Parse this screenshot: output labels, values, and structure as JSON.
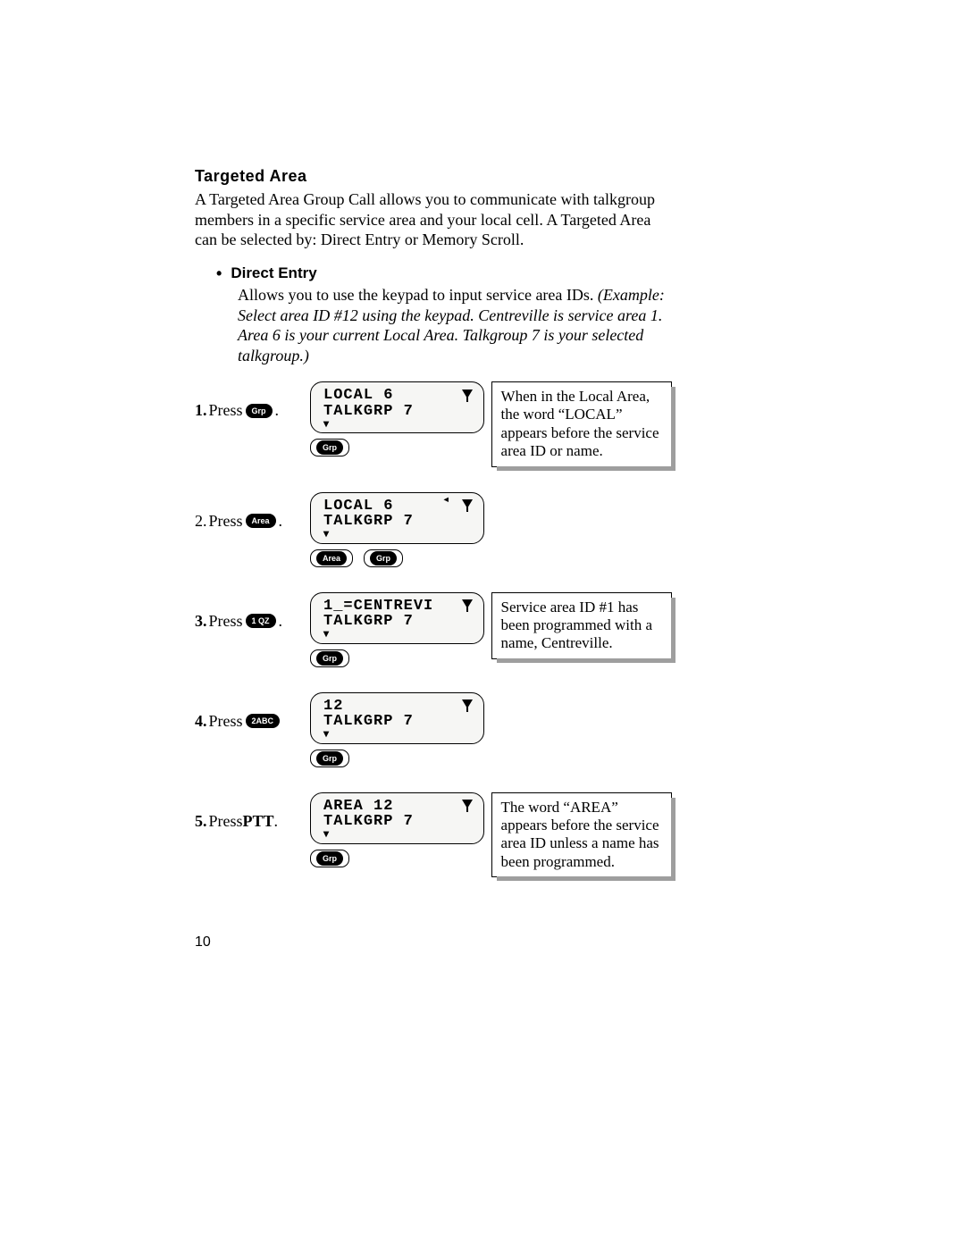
{
  "heading": "Targeted  Area",
  "intro": "A Targeted Area Group Call allows you to communicate with talkgroup members in a specific service area and your local cell. A Targeted Area can be selected by: Direct Entry or Memory Scroll.",
  "sub": {
    "bullet": "•",
    "title": "Direct Entry",
    "body_plain": "Allows you to use the keypad to input service area IDs. ",
    "body_italic": "(Example: Select area ID #12 using the keypad. Centreville is service area 1. Area 6 is your current Local Area. Talkgroup 7 is your selected talkgroup.)"
  },
  "steps": [
    {
      "num": "1.",
      "num_bold": true,
      "press": "Press ",
      "key": "Grp",
      "after_key": ".",
      "ptt": false,
      "lcd": {
        "line1": "LOCAL 6",
        "line2": "TALKGRP 7",
        "signal": false
      },
      "softkeys": [
        "Grp"
      ],
      "callout": "When in the Local Area, the word “LOCAL” appears before the service area ID or name."
    },
    {
      "num": "2.",
      "num_bold": false,
      "press": "Press ",
      "key": "Area",
      "after_key": " .",
      "ptt": false,
      "lcd": {
        "line1": "LOCAL 6",
        "line2": "TALKGRP 7",
        "signal": true
      },
      "softkeys": [
        "Area",
        "Grp"
      ],
      "callout": ""
    },
    {
      "num": "3.",
      "num_bold": true,
      "press": "Press  ",
      "key": "1 QZ",
      "after_key": " .",
      "ptt": false,
      "lcd": {
        "line1": "1_=CENTREVI",
        "line2": "TALKGRP 7",
        "signal": false
      },
      "softkeys": [
        "Grp"
      ],
      "callout": "Service area ID #1 has been programmed with a name, Centreville."
    },
    {
      "num": "4.",
      "num_bold": true,
      "press": "Press ",
      "key": "2ABC",
      "after_key": "",
      "ptt": false,
      "lcd": {
        "line1": "12",
        "line2": "TALKGRP 7",
        "signal": false
      },
      "softkeys": [
        "Grp"
      ],
      "callout": ""
    },
    {
      "num": "5.",
      "num_bold": true,
      "press": "Press ",
      "key": "",
      "after_key": ".",
      "ptt": true,
      "ptt_label": "PTT",
      "lcd": {
        "line1": "AREA 12",
        "line2": "TALKGRP 7",
        "signal": false
      },
      "softkeys": [
        "Grp"
      ],
      "callout": "The word “AREA” appears before the service area ID unless a name has been programmed."
    }
  ],
  "page_number": "10"
}
